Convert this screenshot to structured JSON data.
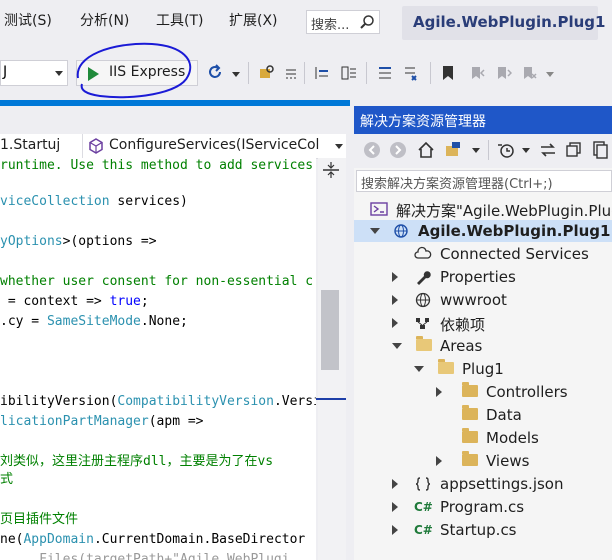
{
  "menu": {
    "test": "测试(S)",
    "analyze": "分析(N)",
    "tools": "工具(T)",
    "extensions": "扩展(X)",
    "search_label": "搜索..."
  },
  "project_title": "Agile.WebPlugin.Plug1",
  "toolbar": {
    "config_value": "J",
    "run_label": "IIS Express"
  },
  "nav": {
    "left": "1.Startuj",
    "right": "ConfigureServices(IServiceCol"
  },
  "code": {
    "l1a": "runtime. Use this method to add services",
    "l2a": "viceCollection",
    "l2b": " services)",
    "l3a": "yOptions",
    "l3b": ">(options =>",
    "l4a": "whether user consent for non-essential c",
    "l5a": " = context => ",
    "l5b": "true",
    "l5c": ";",
    "l6a": ".cy = ",
    "l6b": "SameSiteMode",
    "l6c": ".None;",
    "l7a": "ibilityVersion(",
    "l7b": "CompatibilityVersion",
    "l7c": ".Versi",
    "l8a": "licationPartManager",
    "l8b": "(apm =>",
    "l9a": "刘类似，这里注册主程序dll，主要是为了在vs",
    "l10a": "式",
    "l11a": "页目插件文件",
    "l12a": "ne(",
    "l12b": "AppDomain",
    "l12c": ".CurrentDomain.BaseDirector",
    "l13a": "  ...Files(targetPath+\"Agile.WebPlugi"
  },
  "se": {
    "title": "解决方案资源管理器",
    "search_placeholder": "搜索解决方案资源管理器(Ctrl+;)",
    "solution": "解决方案\"Agile.WebPlugin.Plug",
    "project": "Agile.WebPlugin.Plug1",
    "connected": "Connected Services",
    "properties": "Properties",
    "wwwroot": "wwwroot",
    "deps": "依赖项",
    "areas": "Areas",
    "plug1": "Plug1",
    "controllers": "Controllers",
    "data": "Data",
    "models": "Models",
    "views": "Views",
    "appsettings": "appsettings.json",
    "program": "Program.cs",
    "startup": "Startup.cs"
  },
  "colors": {
    "accent": "#0078d7",
    "se_title_bg": "#1f57c8",
    "keyword": "#0000ff",
    "type": "#2b91af",
    "comment": "#008000",
    "annotation": "#1a1ad6"
  }
}
